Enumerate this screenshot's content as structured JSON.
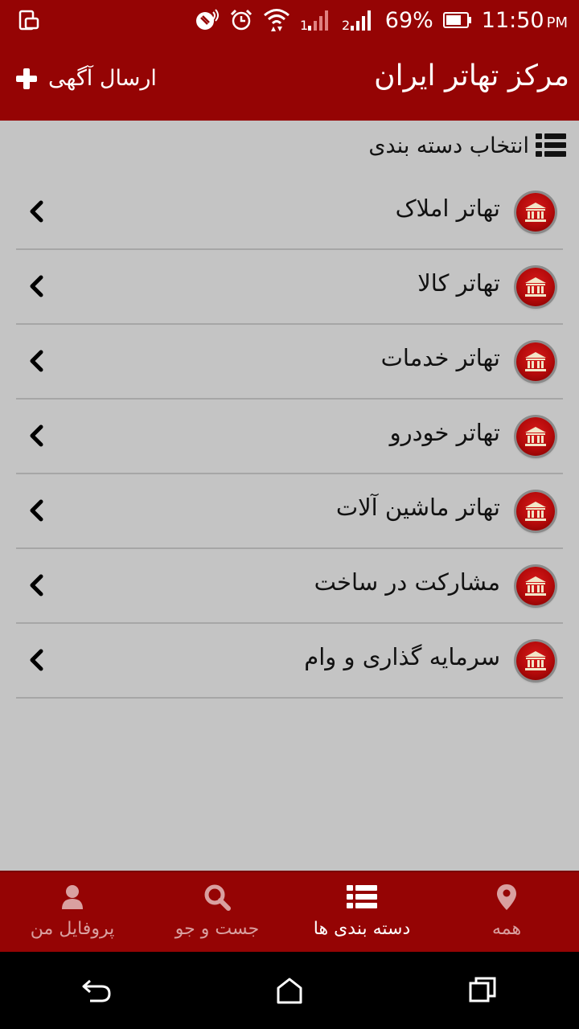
{
  "status_bar": {
    "battery_percent": "69%",
    "time": "11:50",
    "ampm": "PM"
  },
  "app_bar": {
    "title": "مرکز تهاتر ایران",
    "post_ad_label": "ارسال آگهی"
  },
  "section": {
    "title": "انتخاب دسته بندی"
  },
  "categories": [
    {
      "label": "تهاتر املاک"
    },
    {
      "label": "تهاتر کالا"
    },
    {
      "label": "تهاتر خدمات"
    },
    {
      "label": "تهاتر خودرو"
    },
    {
      "label": "تهاتر ماشین آلات"
    },
    {
      "label": "مشارکت در ساخت"
    },
    {
      "label": "سرمایه گذاری و وام"
    }
  ],
  "bottom_nav": {
    "profile": "پروفایل من",
    "search": "جست و جو",
    "categories": "دسته بندی ها",
    "all": "همه"
  },
  "colors": {
    "primary": "#950404",
    "background": "#c4c4c4",
    "inactive_nav": "#d9a0a0"
  }
}
